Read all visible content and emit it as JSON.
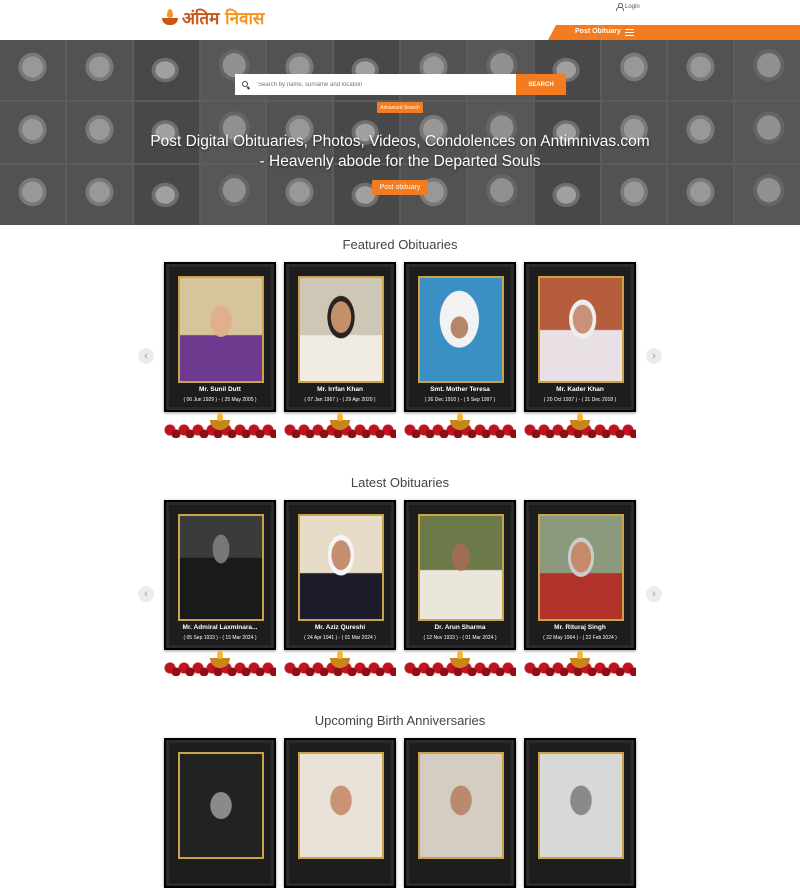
{
  "header": {
    "logo_text_1": "अंतिम",
    "logo_text_2": "निवास",
    "login_label": "Login",
    "post_obituary_label": "Post Obituary"
  },
  "hero": {
    "search_placeholder": "Search by name, surname and location",
    "search_button": "SEARCH",
    "advanced_search": "Advanced Search",
    "headline": "Post Digital Obituaries, Photos, Videos, Condolences on Antimnivas.com - Heavenly abode for the Departed Souls",
    "post_button": "Post obituary"
  },
  "featured": {
    "title": "Featured Obituaries",
    "cards": [
      {
        "name": "Mr. Sunil Dutt",
        "dates": "( 06 Jun 1929 ) - ( 25 May 2005 )"
      },
      {
        "name": "Mr. Irrfan Khan",
        "dates": "( 07 Jan 1967 ) - ( 29 Apr 2020 )"
      },
      {
        "name": "Smt. Mother Teresa",
        "dates": "( 26 Dec 1910 ) - ( 5 Sep 1997 )"
      },
      {
        "name": "Mr. Kader Khan",
        "dates": "( 20 Oct 1937 ) - ( 31 Dec 2018 )"
      }
    ]
  },
  "latest": {
    "title": "Latest Obituaries",
    "cards": [
      {
        "name": "Mr. Admiral Laxminara...",
        "dates": "( 05 Sep 1933 ) - ( 15 Mar 2024 )"
      },
      {
        "name": "Mr. Aziz Qureshi",
        "dates": "( 24 Apr 1941 ) - ( 01 Mar 2024 )"
      },
      {
        "name": "Dr. Arun Sharma",
        "dates": "( 12 Nov 1933 ) - ( 01 Mar 2024 )"
      },
      {
        "name": "Mr. Rituraj Singh",
        "dates": "( 22 May 1964 ) - ( 22 Feb 2024 )"
      }
    ]
  },
  "anniversaries": {
    "title": "Upcoming Birth Anniversaries"
  },
  "icons": {
    "prev": "chevron-left-icon",
    "next": "chevron-right-icon"
  },
  "colors": {
    "accent": "#f47c20",
    "logo_red": "#c8561b"
  }
}
